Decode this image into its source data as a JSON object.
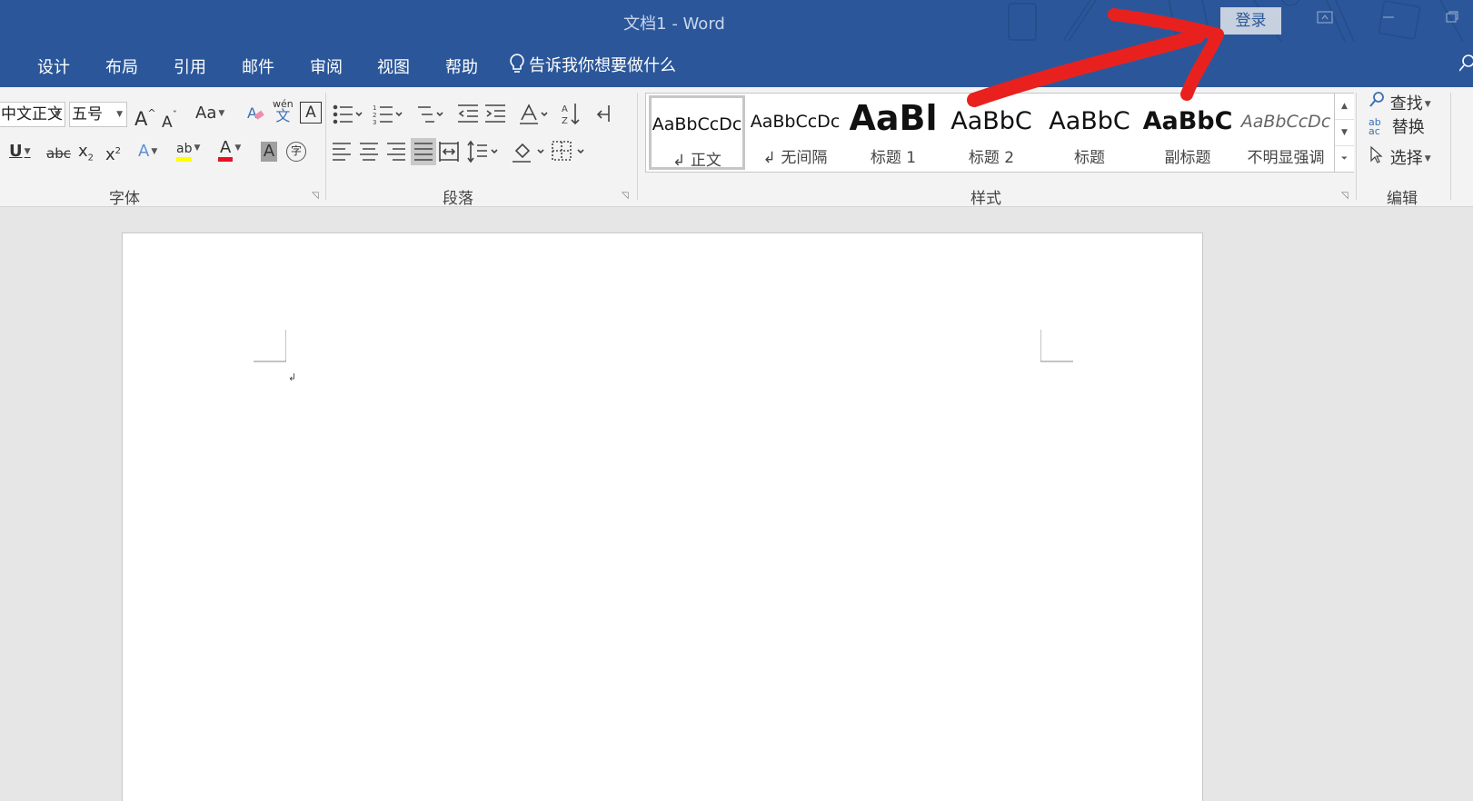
{
  "title_bar": {
    "doc_title": "文档1  -  Word",
    "login_label": "登录",
    "icons": [
      "ribbon-display-icon",
      "minimize-icon",
      "restore-icon"
    ]
  },
  "tabs": [
    "设计",
    "布局",
    "引用",
    "邮件",
    "审阅",
    "视图",
    "帮助"
  ],
  "tell_me": "告诉我你想要做什么",
  "font_group": {
    "label": "字体",
    "font_name": "中文正文",
    "font_size": "五号",
    "change_case": "Aa",
    "phonetic_top": "wén",
    "phonetic_bottom": "文",
    "char_border": "A",
    "underline": "U",
    "strikethrough": "abc",
    "subscript": "x",
    "subscript_sub": "2",
    "superscript": "x",
    "superscript_sup": "2",
    "highlight_text": "ab",
    "font_color_text": "A",
    "char_shading": "A",
    "enclose_char": "字",
    "highlight_color": "#ffff00",
    "font_color": "#e81123"
  },
  "paragraph_group": {
    "label": "段落"
  },
  "styles_group": {
    "label": "样式",
    "items": [
      {
        "preview": "AaBbCcDc",
        "label": "↲ 正文"
      },
      {
        "preview": "AaBbCcDc",
        "label": "↲ 无间隔"
      },
      {
        "preview": "AaBl",
        "label": "标题 1"
      },
      {
        "preview": "AaBbC",
        "label": "标题 2"
      },
      {
        "preview": "AaBbC",
        "label": "标题"
      },
      {
        "preview": "AaBbC",
        "label": "副标题"
      },
      {
        "preview": "AaBbCcDc",
        "label": "不明显强调"
      }
    ]
  },
  "editing_group": {
    "label": "编辑",
    "find": "查找",
    "replace": "替换",
    "select": "选择"
  },
  "document": {
    "paragraph_mark": "↲"
  },
  "colors": {
    "word_blue": "#2b579a",
    "annotation_red": "#e8211f"
  }
}
